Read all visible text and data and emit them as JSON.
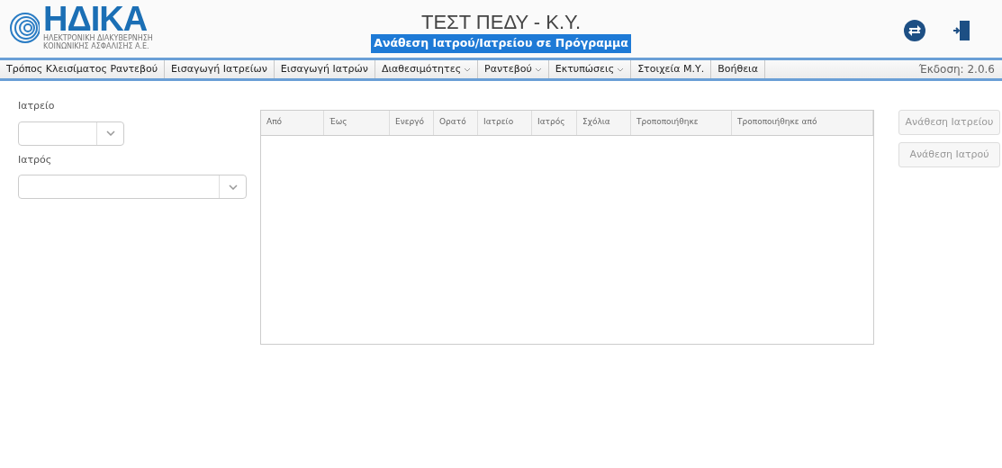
{
  "header": {
    "logo": {
      "name": "ΗΔΙΚΑ",
      "line_1": "ΗΛΕΚΤΡΟΝΙΚΗ ΔΙΑΚΥΒΕΡΝΗΣΗ",
      "line_2": "ΚΟΙΝΩΝΙΚΗΣ ΑΣΦΑΛΙΣΗΣ Α.Ε."
    },
    "title": "ΤΕΣΤ ΠΕΔΥ - Κ.Υ.",
    "subtitle": "Ανάθεση Ιατρού/Ιατρείου σε Πρόγραμμα"
  },
  "menu": [
    {
      "label": "Τρόπος Κλεισίματος Ραντεβού",
      "dropdown": false
    },
    {
      "label": "Εισαγωγή Ιατρείων",
      "dropdown": false
    },
    {
      "label": "Εισαγωγή Ιατρών",
      "dropdown": false
    },
    {
      "label": "Διαθεσιμότητες",
      "dropdown": true
    },
    {
      "label": "Ραντεβού",
      "dropdown": true
    },
    {
      "label": "Εκτυπώσεις",
      "dropdown": true
    },
    {
      "label": "Στοιχεία Μ.Υ.",
      "dropdown": false
    },
    {
      "label": "Βοήθεια",
      "dropdown": false
    }
  ],
  "version": "Έκδοση: 2.0.6",
  "filters": [
    {
      "label": "Ιατρείο"
    },
    {
      "label": "Ιατρός"
    }
  ],
  "table": {
    "columns": [
      "Από",
      "Έως",
      "Ενεργό",
      "Ορατό",
      "Ιατρείο",
      "Ιατρός",
      "Σχόλια",
      "Τροποποιήθηκε",
      "Τροποποιήθηκε από"
    ]
  },
  "buttons": [
    {
      "label": "Ανάθεση Ιατρείου",
      "disabled": true
    },
    {
      "label": "Ανάθεση Ιατρού",
      "disabled": true
    }
  ]
}
